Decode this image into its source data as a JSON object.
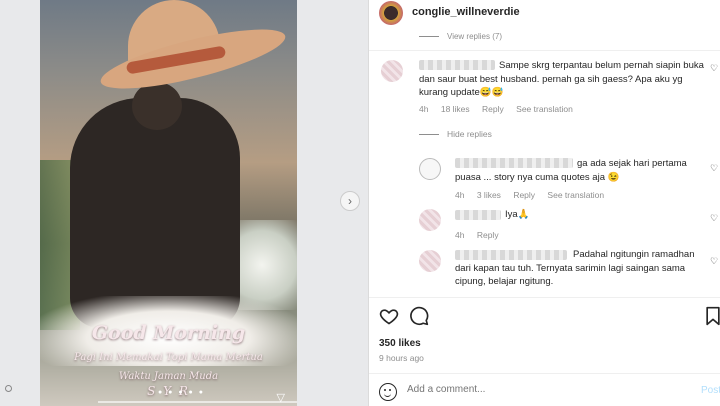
{
  "post": {
    "username": "conglie_willneverdie",
    "caption": {
      "greeting": "Good Morning",
      "line1": "Pagi Ini Memakai Topi Mama Mertua",
      "line2": "Waktu Jaman Muda",
      "signature": "S Y R"
    }
  },
  "comments": {
    "view_replies": "View replies (7)",
    "hide_replies": "Hide replies",
    "main": {
      "text": "Sampe skrg terpantau belum pernah siapin buka dan saur buat best husband. pernah ga sih gaess? Apa aku yg kurang update😅😅",
      "time": "4h",
      "likes": "18 likes",
      "reply": "Reply",
      "translation": "See translation"
    },
    "reply1": {
      "text": "ga ada sejak hari pertama puasa ... story nya cuma quotes aja 😉",
      "time": "4h",
      "likes": "3 likes",
      "reply": "Reply",
      "translation": "See translation"
    },
    "reply2": {
      "text": "Iya🙏",
      "time": "4h",
      "reply": "Reply"
    },
    "reply3": {
      "text": "Padahal ngitungin ramadhan dari kapan tau tuh. Ternyata sarimin lagi saingan sama cipung, belajar ngitung."
    }
  },
  "footer": {
    "likes": "350 likes",
    "time": "9 hours ago",
    "add_comment_placeholder": "Add a comment...",
    "post_label": "Post"
  },
  "icons": [
    "heart-icon",
    "comment-icon",
    "bookmark-icon",
    "emoji-icon",
    "next-arrow-icon"
  ]
}
